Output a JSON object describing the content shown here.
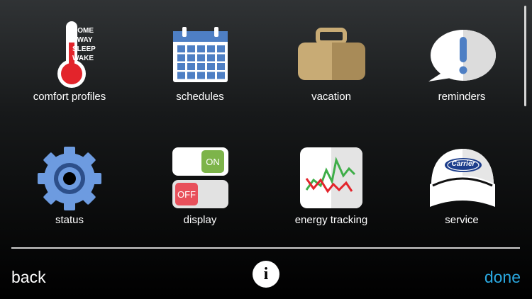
{
  "tiles": [
    {
      "id": "comfort-profiles",
      "label": "comfort profiles",
      "icon": "thermometer-icon",
      "modes": [
        "HOME",
        "AWAY",
        "SLEEP",
        "WAKE"
      ]
    },
    {
      "id": "schedules",
      "label": "schedules",
      "icon": "calendar-icon"
    },
    {
      "id": "vacation",
      "label": "vacation",
      "icon": "suitcase-icon"
    },
    {
      "id": "reminders",
      "label": "reminders",
      "icon": "speech-bubble-exclamation-icon"
    },
    {
      "id": "status",
      "label": "status",
      "icon": "gear-icon"
    },
    {
      "id": "display",
      "label": "display",
      "icon": "toggle-switches-icon",
      "on_label": "ON",
      "off_label": "OFF"
    },
    {
      "id": "energy-tracking",
      "label": "energy tracking",
      "icon": "line-graph-icon"
    },
    {
      "id": "service",
      "label": "service",
      "icon": "carrier-cap-icon",
      "brand": "Carrier"
    }
  ],
  "footer": {
    "back_label": "back",
    "info_label": "i",
    "done_label": "done"
  },
  "colors": {
    "accent": "#2aa8e0",
    "thermometer_red": "#e3242b",
    "calendar_blue": "#4e7fc4",
    "suitcase_tan": "#c8ab75",
    "gear_blue": "#6d9be0",
    "on_green": "#7db44a",
    "off_red": "#e8505b",
    "graph_green": "#3fae49",
    "carrier_navy": "#1d3e8c"
  }
}
